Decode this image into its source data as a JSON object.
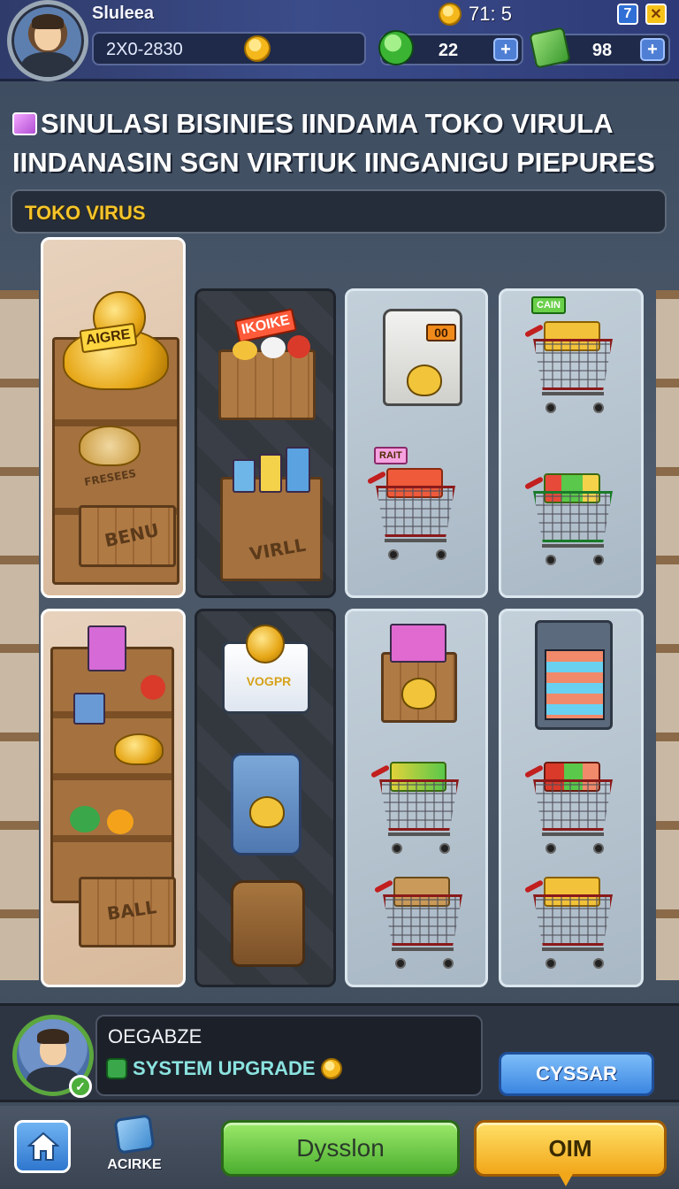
{
  "topbar": {
    "player_name": "Sluleea",
    "player_id": "2X0-2830",
    "timer": "71: 5",
    "info_label": "7",
    "close_label": "✕",
    "gems": "22",
    "cash": "98",
    "plus_label": "+"
  },
  "heading": {
    "line1": "SINULASI BISINIES IINDAMA TOKO VIRULA",
    "line2": "IINDANASIN SGN VIRTIUK IINGANIGU PIEPURES"
  },
  "section": {
    "title": "TOKO VIRUS"
  },
  "tiles": {
    "col1_top": {
      "sign": "AIGRE",
      "label": "BENU",
      "mid_label": "FRESEES"
    },
    "col2_top": {
      "sign": "IKOIKE",
      "label": "VIRLL"
    },
    "col3_top": {
      "bin_label": "00",
      "cart_sign": "RAIT"
    },
    "col4_top": {
      "cart_sign": "CAIN"
    },
    "col1_bot": {
      "label": "BALL"
    },
    "col2_bot": {
      "card_label": "VOGPR"
    }
  },
  "dialog": {
    "speaker": "OEGABZE",
    "message": "SYSTEM UPGRADE",
    "action_label": "CYSSAR"
  },
  "nav": {
    "acirke_label": "ACIRKE",
    "green_label": "Dysslon",
    "yellow_label": "OIM"
  },
  "colors": {
    "accent_gold": "#f6c52a",
    "green_button": "#4caf2f",
    "yellow_button": "#f2a71a",
    "blue_button": "#3b86e2"
  },
  "icons": [
    "avatar",
    "coin-icon",
    "gem-icon",
    "cash-icon",
    "plus-icon",
    "info-icon",
    "close-icon",
    "tag-icon",
    "home-icon",
    "dice-icon",
    "check-icon"
  ]
}
